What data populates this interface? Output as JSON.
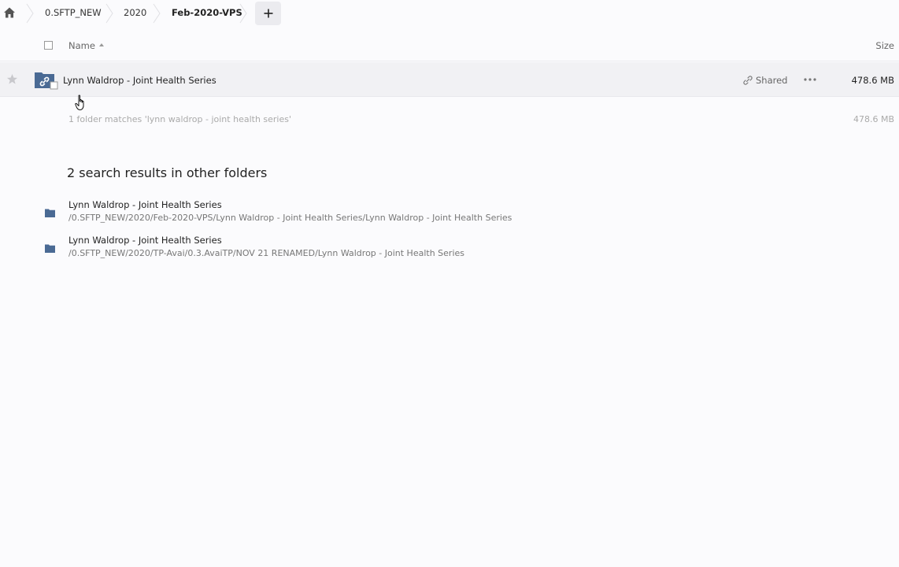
{
  "breadcrumb": {
    "home_icon": "home-icon",
    "items": [
      "0.SFTP_NEW",
      "2020",
      "Feb-2020-VPS"
    ],
    "add_icon": "plus-icon"
  },
  "header": {
    "name_label": "Name",
    "size_label": "Size"
  },
  "file_row": {
    "name": "Lynn Waldrop - Joint Health Series",
    "shared_label": "Shared",
    "size": "478.6 MB"
  },
  "summary": {
    "text": "1 folder matches 'lynn waldrop - joint health series'",
    "size": "478.6 MB"
  },
  "other_results": {
    "title": "2 search results in other folders",
    "items": [
      {
        "name": "Lynn Waldrop - Joint Health Series",
        "path": "/0.SFTP_NEW/2020/Feb-2020-VPS/Lynn Waldrop - Joint Health Series/Lynn Waldrop - Joint Health Series"
      },
      {
        "name": "Lynn Waldrop - Joint Health Series",
        "path": "/0.SFTP_NEW/2020/TP-Avai/0.3.AvaiTP/NOV 21 RENAMED/Lynn Waldrop - Joint Health Series"
      }
    ]
  },
  "colors": {
    "folder": "#4a6a94",
    "row_highlight": "#f1f1f4",
    "muted_text": "#aaaaaa"
  }
}
